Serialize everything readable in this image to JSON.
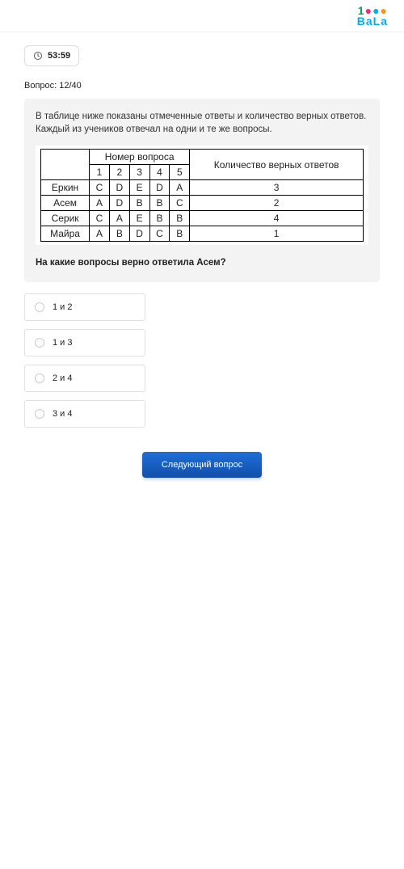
{
  "header": {
    "logo_top": "1●●●",
    "logo_bottom": "BaLa"
  },
  "timer": "53:59",
  "counter": "Вопрос: 12/40",
  "prompt": "В таблице ниже показаны отмеченные ответы и количество верных ответов. Каждый из учеников отвечал на одни и те же вопросы.",
  "table": {
    "top_header": "Номер вопроса",
    "cols": [
      "1",
      "2",
      "3",
      "4",
      "5"
    ],
    "count_header": "Количество верных ответов",
    "rows": [
      {
        "name": "Еркин",
        "ans": [
          "C",
          "D",
          "E",
          "D",
          "A"
        ],
        "correct": "3"
      },
      {
        "name": "Асем",
        "ans": [
          "A",
          "D",
          "B",
          "B",
          "C"
        ],
        "correct": "2"
      },
      {
        "name": "Серик",
        "ans": [
          "C",
          "A",
          "E",
          "B",
          "B"
        ],
        "correct": "4"
      },
      {
        "name": "Майра",
        "ans": [
          "A",
          "B",
          "D",
          "C",
          "B"
        ],
        "correct": "1"
      }
    ]
  },
  "question": "На какие вопросы верно ответила Асем?",
  "options": [
    "1 и 2",
    "1 и 3",
    "2 и 4",
    "3 и 4"
  ],
  "next_label": "Следующий вопрос"
}
